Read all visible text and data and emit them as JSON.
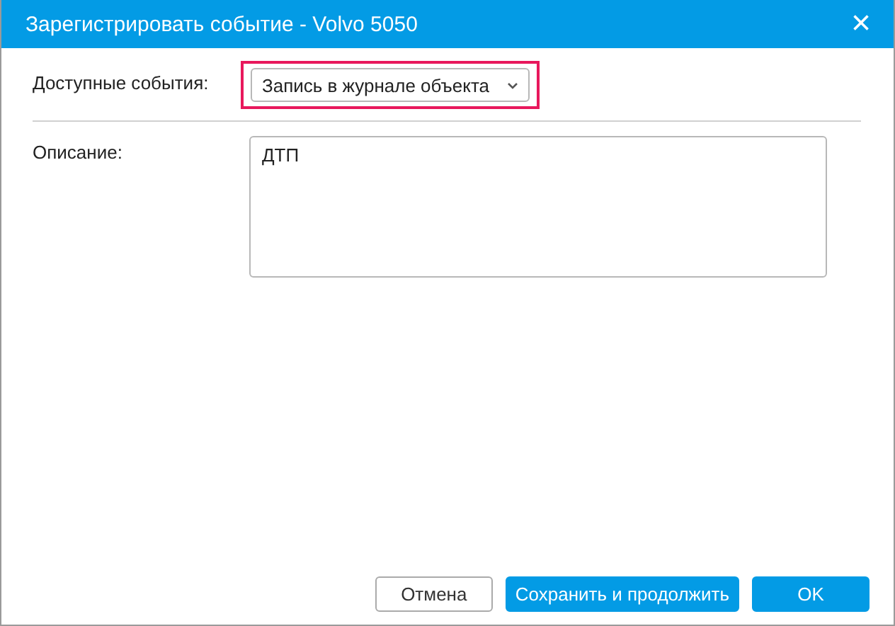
{
  "window": {
    "title": "Зарегистрировать событие - Volvo 5050",
    "close": "×"
  },
  "event_field": {
    "label": "Доступные события:",
    "value": "Запись в журнале объекта",
    "highlighted": true
  },
  "description_field": {
    "label": "Описание:",
    "value": "ДТП"
  },
  "buttons": [
    {
      "label": "Отмена",
      "kind": "secondary"
    },
    {
      "label": "Сохранить и продолжить",
      "kind": "primary"
    },
    {
      "label": "OK",
      "kind": "primary"
    }
  ]
}
